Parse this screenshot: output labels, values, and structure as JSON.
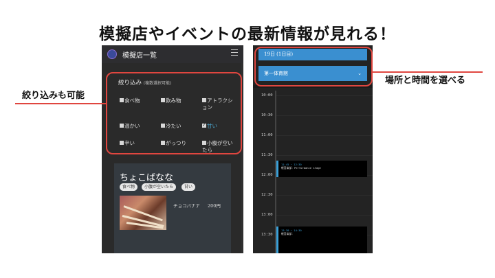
{
  "headline": "模擬店やイベントの最新情報が見れる！",
  "left_screen": {
    "header_title": "模擬店一覧",
    "filter": {
      "title": "絞り込み",
      "note": "(複数選択可能)",
      "options": [
        {
          "label": "食べ物",
          "checked": false
        },
        {
          "label": "飲み物",
          "checked": false
        },
        {
          "label": "アトラクション",
          "checked": false
        },
        {
          "label": "温かい",
          "checked": false
        },
        {
          "label": "冷たい",
          "checked": false
        },
        {
          "label": "甘い",
          "checked": true
        },
        {
          "label": "辛い",
          "checked": false
        },
        {
          "label": "がっつり",
          "checked": false
        },
        {
          "label": "小腹が空いたら",
          "checked": false
        }
      ]
    },
    "card": {
      "title": "ちょこばなな",
      "tags": [
        "食べ物",
        "小腹が空いたら",
        "甘い"
      ],
      "item_name": "チョコバナナ",
      "item_price": "200円"
    }
  },
  "right_screen": {
    "date_select": "19日 (1日目)",
    "venue_select": "第一体育館",
    "times": [
      "10:00",
      "10:30",
      "11:00",
      "11:30",
      "12:00",
      "12:30",
      "13:00",
      "13:30"
    ],
    "events": [
      {
        "time": "11:45 ~ 12:30",
        "name": "軽音楽部：Performance stage"
      },
      {
        "time": "13:30 ~ 14:30",
        "name": "軽音楽部："
      }
    ]
  },
  "annotations": {
    "left_callout": "絞り込みも可能",
    "right_callout": "場所と時間を選べる"
  },
  "colors": {
    "accent_blue": "#3a8fd0",
    "annotation_red": "#e0463f",
    "active_filter": "#4aa3c9"
  }
}
